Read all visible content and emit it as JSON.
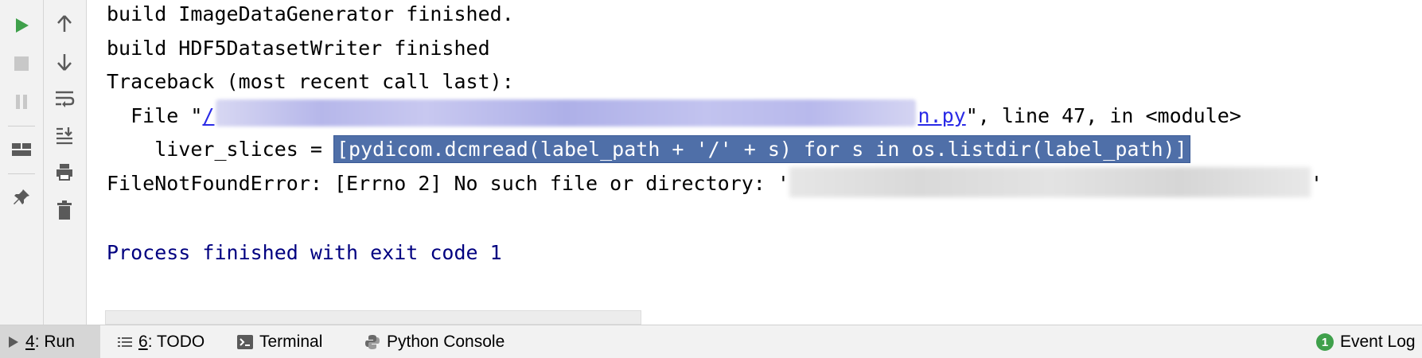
{
  "console": {
    "lines": {
      "l1": "build ImageDataGenerator finished.",
      "l2": "build HDF5DatasetWriter finished",
      "l3": "Traceback (most recent call last):",
      "file_prefix": "  File \"",
      "file_link_start": "/",
      "file_link_end": "n.py",
      "file_suffix": "\", line 47, in <module>",
      "code_prefix": "    liver_slices = ",
      "code_selected": "[pydicom.dcmread(label_path + '/' + s) for s in os.listdir(label_path)]",
      "error_prefix": "FileNotFoundError: [Errno 2] No such file or directory: '",
      "error_suffix": "'",
      "process": "Process finished with exit code 1"
    }
  },
  "toolbar": {
    "run_icon": "run-icon",
    "stop_icon": "stop-icon",
    "pause_icon": "pause-icon",
    "layout_icon": "layout-icon",
    "pin_icon": "pin-icon",
    "up_icon": "arrow-up-icon",
    "down_icon": "arrow-down-icon",
    "wrap_icon": "soft-wrap-icon",
    "scroll_end_icon": "scroll-to-end-icon",
    "print_icon": "print-icon",
    "trash_icon": "trash-icon"
  },
  "bottom_tabs": {
    "run_num": "4",
    "run_label": ": Run",
    "todo_num": "6",
    "todo_label": ": TODO",
    "terminal_label": "Terminal",
    "python_console_label": "Python Console",
    "event_log_count": "1",
    "event_log_label": "Event Log"
  },
  "colors": {
    "selection": "#4f6fa8",
    "link": "#2a2ae6",
    "process_text": "#000080",
    "run_green": "#3fa04b"
  }
}
